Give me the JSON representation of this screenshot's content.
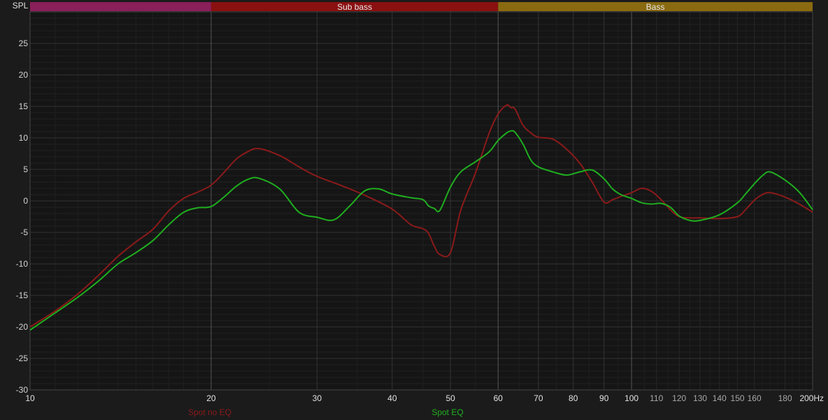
{
  "chart_data": {
    "type": "line",
    "ylabel": "SPL",
    "xlabel": "",
    "x_scale": "log",
    "xlim": [
      10,
      200
    ],
    "ylim": [
      -30,
      30
    ],
    "grid": true,
    "x_ticks": [
      {
        "value": 10,
        "label": "10",
        "major": true
      },
      {
        "value": 20,
        "label": "20",
        "major": true
      },
      {
        "value": 30,
        "label": "30",
        "major": true
      },
      {
        "value": 40,
        "label": "40",
        "major": true
      },
      {
        "value": 50,
        "label": "50",
        "major": true
      },
      {
        "value": 60,
        "label": "60",
        "major": true
      },
      {
        "value": 70,
        "label": "70",
        "major": true
      },
      {
        "value": 80,
        "label": "80",
        "major": true
      },
      {
        "value": 90,
        "label": "90",
        "major": true
      },
      {
        "value": 100,
        "label": "100",
        "major": true
      },
      {
        "value": 110,
        "label": "110",
        "major": false
      },
      {
        "value": 120,
        "label": "120",
        "major": false
      },
      {
        "value": 130,
        "label": "130",
        "major": false
      },
      {
        "value": 140,
        "label": "140",
        "major": false
      },
      {
        "value": 150,
        "label": "150",
        "major": false
      },
      {
        "value": 160,
        "label": "160",
        "major": false
      },
      {
        "value": 180,
        "label": "180",
        "major": false
      },
      {
        "value": 200,
        "label": "200Hz",
        "major": true
      }
    ],
    "y_ticks": [
      {
        "value": 25,
        "label": "25"
      },
      {
        "value": 20,
        "label": "20"
      },
      {
        "value": 15,
        "label": "15"
      },
      {
        "value": 10,
        "label": "10"
      },
      {
        "value": 5,
        "label": "5"
      },
      {
        "value": 0,
        "label": "0"
      },
      {
        "value": -5,
        "label": "-5"
      },
      {
        "value": -10,
        "label": "-10"
      },
      {
        "value": -15,
        "label": "-15"
      },
      {
        "value": -20,
        "label": "-20"
      },
      {
        "value": -25,
        "label": "-25"
      },
      {
        "value": -30,
        "label": "-30"
      }
    ],
    "bands": [
      {
        "label": "",
        "from": 10,
        "to": 20,
        "color": "#8a1f5a"
      },
      {
        "label": "Sub bass",
        "from": 20,
        "to": 60,
        "color": "#8b1010"
      },
      {
        "label": "Bass",
        "from": 60,
        "to": 200,
        "color": "#8a6a10"
      }
    ],
    "series": [
      {
        "name": "Spot no EQ",
        "color": "#8b1a1a",
        "x": [
          10,
          11,
          12,
          13,
          14,
          15,
          16,
          17,
          18,
          19,
          20,
          21,
          22,
          23,
          24,
          26,
          28,
          30,
          33,
          36,
          40,
          43,
          45,
          46,
          47,
          48,
          50,
          52,
          55,
          58,
          60,
          62,
          63,
          64,
          66,
          68,
          70,
          74,
          78,
          82,
          86,
          90,
          93,
          96,
          100,
          104,
          108,
          112,
          116,
          120,
          125,
          130,
          140,
          150,
          155,
          160,
          165,
          170,
          180,
          190,
          200
        ],
        "y": [
          -20,
          -17.5,
          -14.8,
          -11.8,
          -8.8,
          -6.5,
          -4.5,
          -1.6,
          0.4,
          1.4,
          2.5,
          4.5,
          6.6,
          7.8,
          8.3,
          7.2,
          5.4,
          3.9,
          2.4,
          0.9,
          -1.3,
          -3.8,
          -4.4,
          -5.2,
          -7.2,
          -8.5,
          -8.2,
          -1.5,
          4.4,
          10.8,
          13.8,
          15.2,
          14.8,
          14.6,
          12.0,
          10.8,
          10.1,
          9.8,
          8.2,
          6.0,
          3.0,
          -0.2,
          0.2,
          0.7,
          1.3,
          2.0,
          1.5,
          0.2,
          -1.4,
          -2.5,
          -2.7,
          -2.7,
          -2.8,
          -2.5,
          -1.3,
          0.1,
          1.0,
          1.3,
          0.6,
          -0.5,
          -1.8
        ]
      },
      {
        "name": "Spot EQ",
        "color": "#1fae1f",
        "x": [
          10,
          11,
          12,
          13,
          14,
          15,
          16,
          17,
          18,
          19,
          20,
          21,
          22,
          23,
          24,
          26,
          28,
          30,
          32,
          34,
          36,
          38,
          40,
          43,
          45,
          46,
          47,
          48,
          50,
          52,
          55,
          58,
          60,
          62,
          63,
          64,
          66,
          68,
          70,
          74,
          78,
          82,
          86,
          90,
          93,
          96,
          100,
          104,
          108,
          112,
          116,
          120,
          125,
          130,
          140,
          150,
          155,
          160,
          165,
          170,
          180,
          190,
          200
        ],
        "y": [
          -20.5,
          -17.8,
          -15.3,
          -12.7,
          -10,
          -8.2,
          -6.3,
          -3.8,
          -1.8,
          -1.1,
          -0.9,
          0.6,
          2.3,
          3.4,
          3.6,
          1.9,
          -1.8,
          -2.6,
          -3.0,
          -0.8,
          1.6,
          1.9,
          1.1,
          0.5,
          0.2,
          -0.8,
          -1.2,
          -1.5,
          2.2,
          4.6,
          6.2,
          7.8,
          9.6,
          10.8,
          11.1,
          10.9,
          9.0,
          6.5,
          5.4,
          4.6,
          4.1,
          4.6,
          4.9,
          3.5,
          1.9,
          1.0,
          0.4,
          -0.3,
          -0.5,
          -0.4,
          -1.0,
          -2.4,
          -3.1,
          -3.1,
          -2.2,
          -0.3,
          1.2,
          2.7,
          4.0,
          4.6,
          3.3,
          1.4,
          -1.4
        ]
      }
    ]
  }
}
